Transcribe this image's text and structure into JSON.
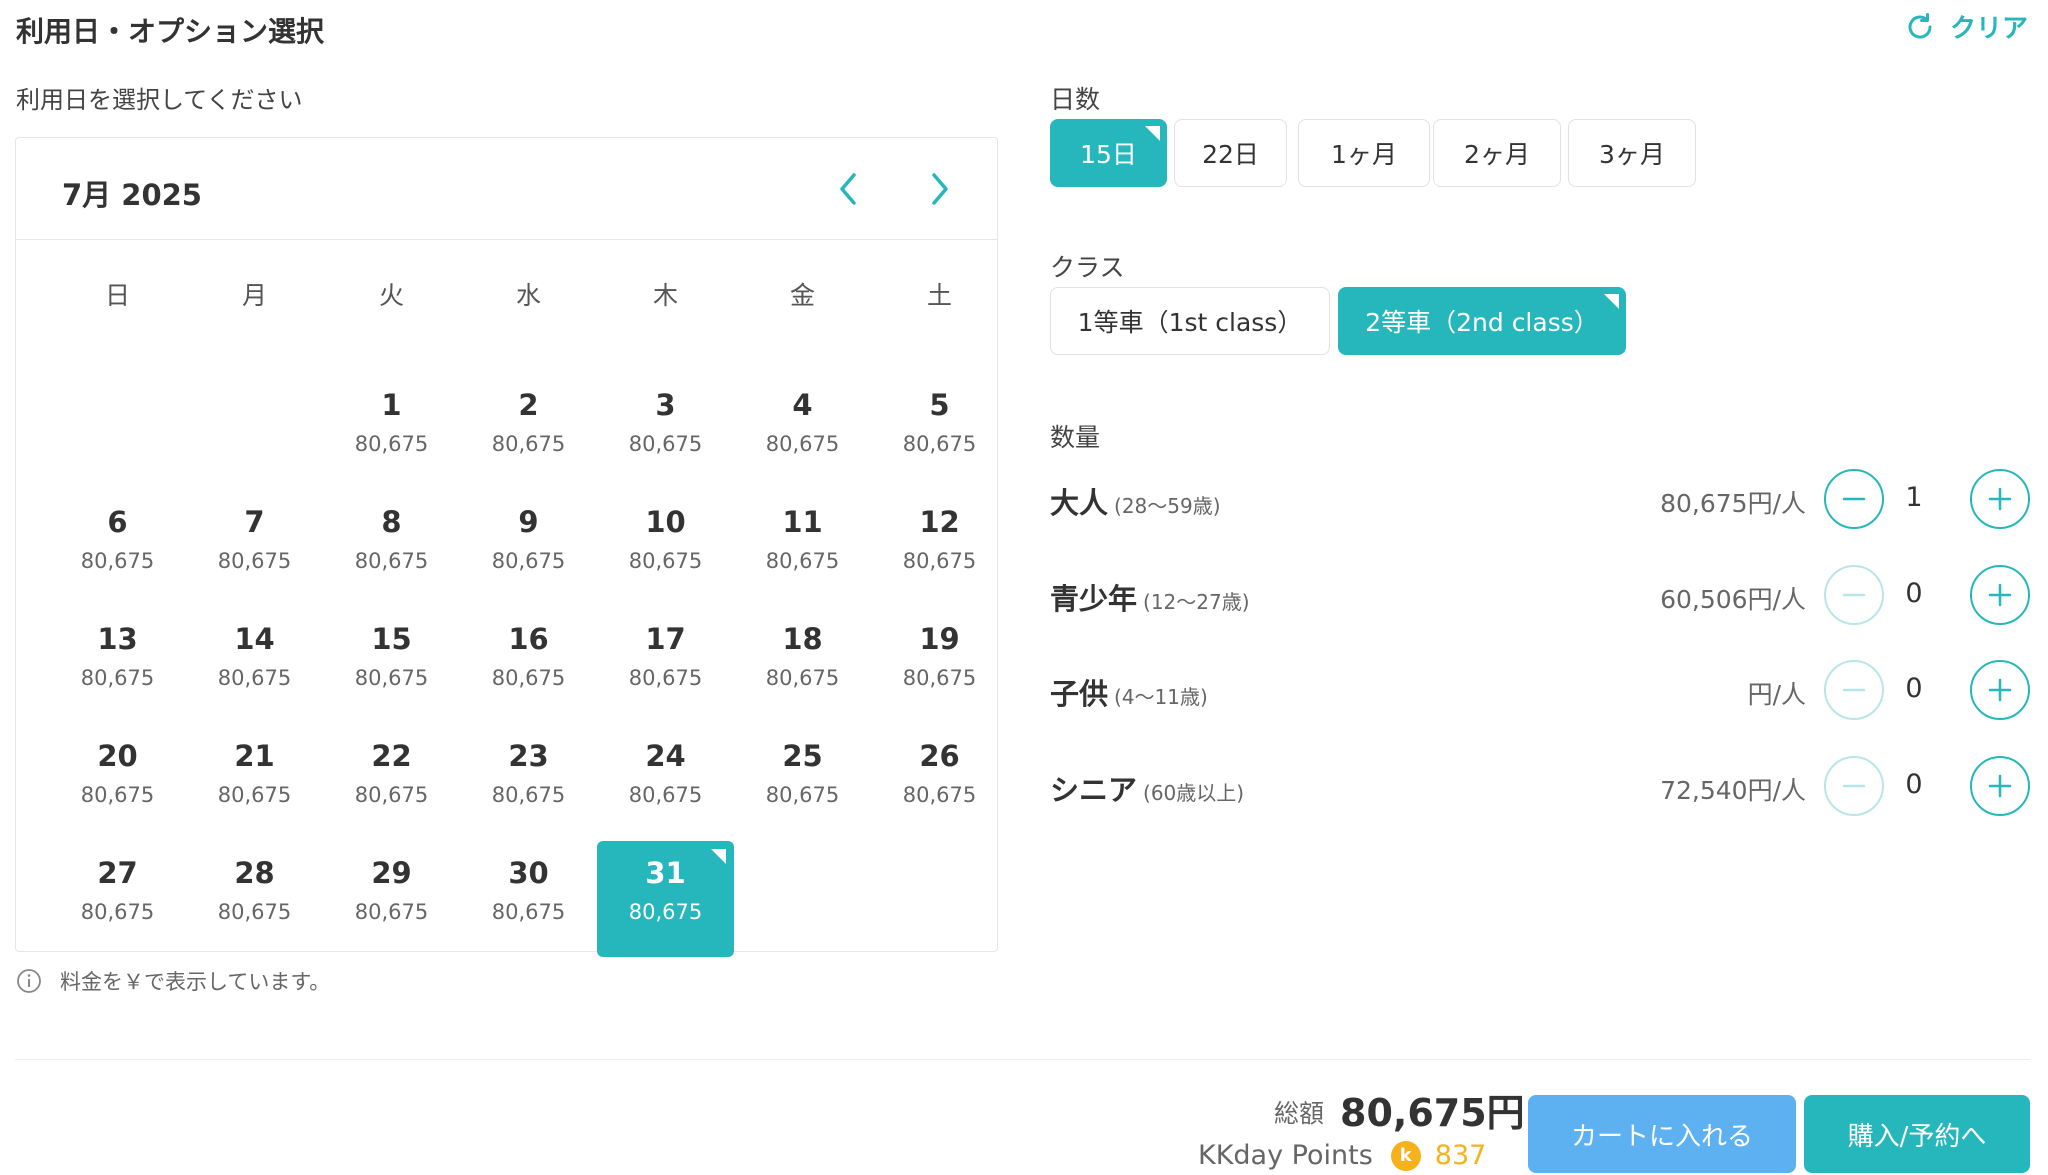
{
  "page_title": "利用日・オプション選択",
  "clear_label": "クリア",
  "calendar": {
    "hint": "利用日を選択してください",
    "month_label": "7月 2025",
    "weekdays": [
      "日",
      "月",
      "火",
      "水",
      "木",
      "金",
      "土"
    ],
    "days": [
      {
        "day": "1",
        "price": "80,675"
      },
      {
        "day": "2",
        "price": "80,675"
      },
      {
        "day": "3",
        "price": "80,675"
      },
      {
        "day": "4",
        "price": "80,675"
      },
      {
        "day": "5",
        "price": "80,675"
      },
      {
        "day": "6",
        "price": "80,675"
      },
      {
        "day": "7",
        "price": "80,675"
      },
      {
        "day": "8",
        "price": "80,675"
      },
      {
        "day": "9",
        "price": "80,675"
      },
      {
        "day": "10",
        "price": "80,675"
      },
      {
        "day": "11",
        "price": "80,675"
      },
      {
        "day": "12",
        "price": "80,675"
      },
      {
        "day": "13",
        "price": "80,675"
      },
      {
        "day": "14",
        "price": "80,675"
      },
      {
        "day": "15",
        "price": "80,675"
      },
      {
        "day": "16",
        "price": "80,675"
      },
      {
        "day": "17",
        "price": "80,675"
      },
      {
        "day": "18",
        "price": "80,675"
      },
      {
        "day": "19",
        "price": "80,675"
      },
      {
        "day": "20",
        "price": "80,675"
      },
      {
        "day": "21",
        "price": "80,675"
      },
      {
        "day": "22",
        "price": "80,675"
      },
      {
        "day": "23",
        "price": "80,675"
      },
      {
        "day": "24",
        "price": "80,675"
      },
      {
        "day": "25",
        "price": "80,675"
      },
      {
        "day": "26",
        "price": "80,675"
      },
      {
        "day": "27",
        "price": "80,675"
      },
      {
        "day": "28",
        "price": "80,675"
      },
      {
        "day": "29",
        "price": "80,675"
      },
      {
        "day": "30",
        "price": "80,675"
      },
      {
        "day": "31",
        "price": "80,675",
        "selected": true
      }
    ],
    "note": "料金を￥で表示しています。"
  },
  "duration": {
    "label": "日数",
    "options": [
      {
        "label": "15日",
        "selected": true
      },
      {
        "label": "22日"
      },
      {
        "label": "1ヶ月"
      },
      {
        "label": "2ヶ月"
      },
      {
        "label": "3ヶ月"
      }
    ]
  },
  "class_option": {
    "label": "クラス",
    "options": [
      {
        "label": "1等車（1st class）"
      },
      {
        "label": "2等車（2nd class）",
        "selected": true
      }
    ]
  },
  "quantity": {
    "label": "数量",
    "rows": [
      {
        "name": "大人",
        "age": "(28〜59歳)",
        "price": "80,675円/人",
        "value": "1",
        "minus_enabled": true
      },
      {
        "name": "青少年",
        "age": "(12〜27歳)",
        "price": "60,506円/人",
        "value": "0",
        "minus_enabled": false
      },
      {
        "name": "子供",
        "age": "(4〜11歳)",
        "price": "円/人",
        "value": "0",
        "minus_enabled": false
      },
      {
        "name": "シニア",
        "age": "(60歳以上)",
        "price": "72,540円/人",
        "value": "0",
        "minus_enabled": false
      }
    ]
  },
  "footer": {
    "total_label": "総額",
    "total_amount": "80,675円",
    "points_label": "KKday Points",
    "points_coin": "k",
    "points_value": "837",
    "cart_button": "カートに入れる",
    "buy_button": "購入/予約へ"
  },
  "colors": {
    "accent": "#26b7bc",
    "cart_blue": "#5eb1f0",
    "points_gold": "#f6b21b"
  }
}
